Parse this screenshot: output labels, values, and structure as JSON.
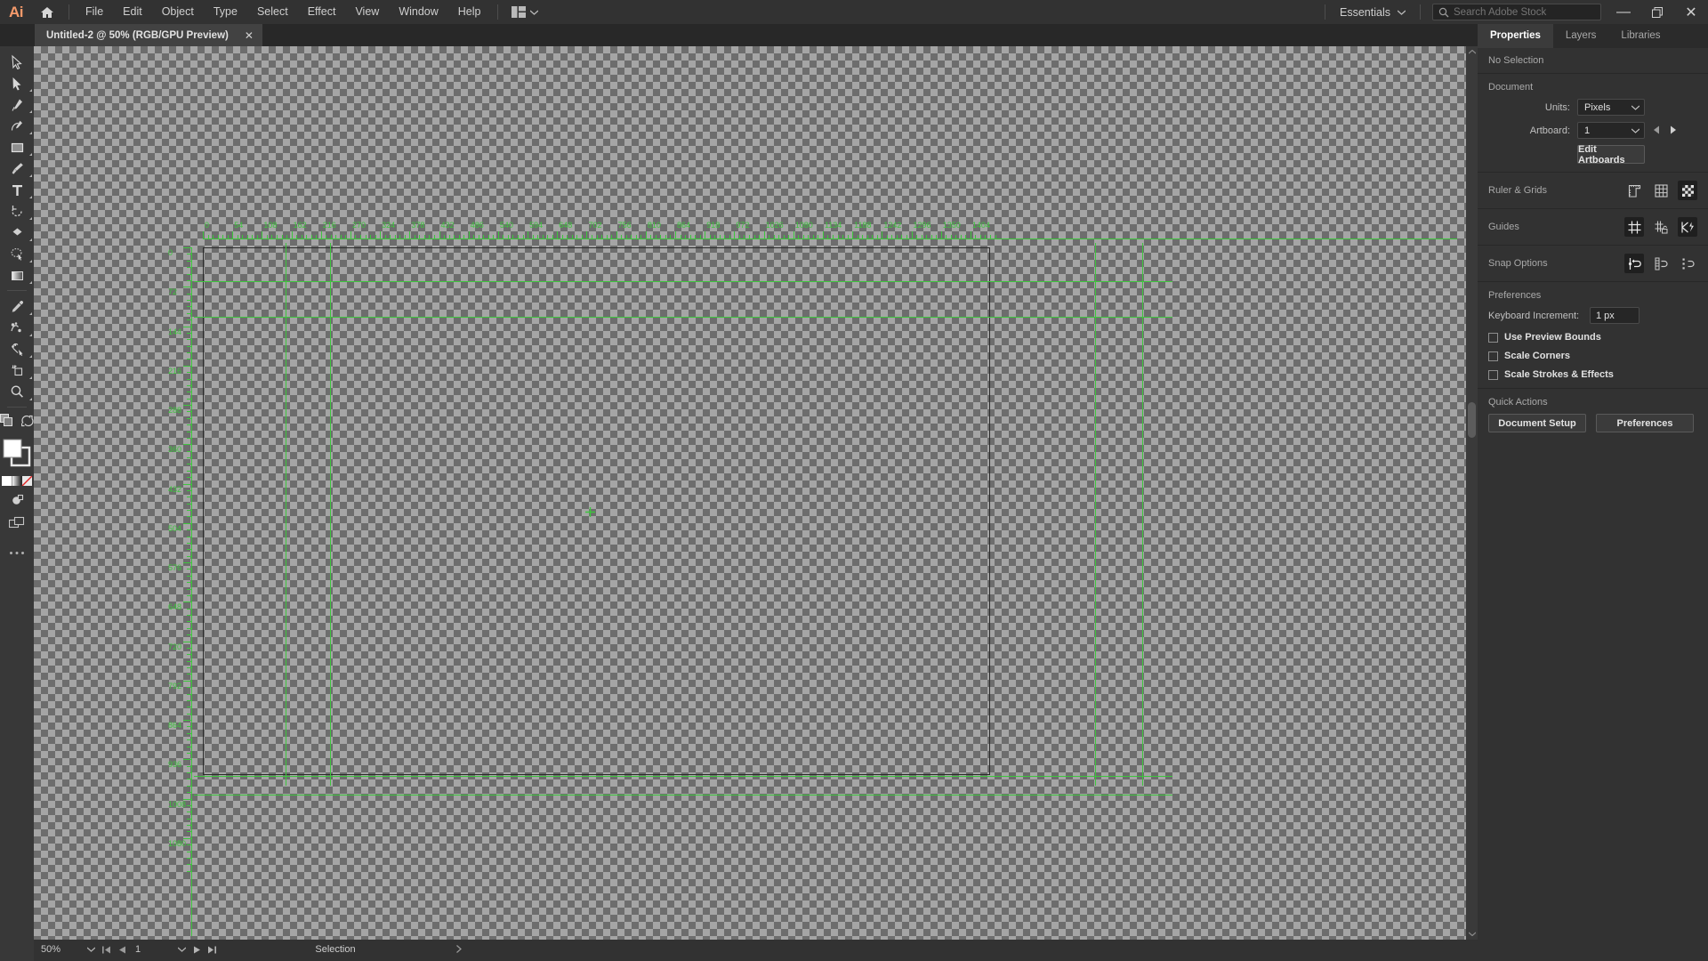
{
  "app": {
    "name": "Ai",
    "home_icon": "home-icon"
  },
  "menu": {
    "items": [
      "File",
      "Edit",
      "Object",
      "Type",
      "Select",
      "Effect",
      "View",
      "Window",
      "Help"
    ],
    "workspace_switcher_icon": "layout-switcher-icon"
  },
  "menubar_right": {
    "workspace": "Essentials",
    "search_placeholder": "Search Adobe Stock",
    "search_value": "",
    "search_icon": "search-icon",
    "minimize": "—",
    "restore": "❐",
    "close": "✕"
  },
  "document_tab": {
    "title": "Untitled-2 @ 50% (RGB/GPU Preview)",
    "close": "✕"
  },
  "panel_collapse_icon": "double-chevron-right-icon",
  "toolbar": {
    "tools": [
      {
        "name": "selection-tool",
        "icon": "arrow-outline-icon",
        "more": false
      },
      {
        "name": "direct-selection-tool",
        "icon": "arrow-solid-icon",
        "more": true
      },
      {
        "name": "pen-tool",
        "icon": "pen-icon",
        "more": true
      },
      {
        "name": "curvature-tool",
        "icon": "curvature-icon",
        "more": true
      },
      {
        "name": "rectangle-tool",
        "icon": "rectangle-icon",
        "more": true
      },
      {
        "name": "paintbrush-tool",
        "icon": "paintbrush-icon",
        "more": true
      },
      {
        "name": "type-tool",
        "icon": "type-icon",
        "more": true
      },
      {
        "name": "rotate-tool",
        "icon": "rotate-icon",
        "more": true
      },
      {
        "name": "shape-builder-tool",
        "icon": "shape-builder-icon",
        "more": true
      },
      {
        "name": "free-transform-tool",
        "icon": "free-transform-icon",
        "more": true
      },
      {
        "name": "gradient-tool",
        "icon": "gradient-icon",
        "more": true
      },
      {
        "name": "eyedropper-tool",
        "icon": "eyedropper-icon",
        "more": true
      },
      {
        "name": "blend-tool",
        "icon": "blend-icon",
        "more": true
      },
      {
        "name": "symbol-sprayer-tool",
        "icon": "symbol-sprayer-icon",
        "more": true
      },
      {
        "name": "artboard-tool",
        "icon": "artboard-icon",
        "more": true
      },
      {
        "name": "zoom-tool",
        "icon": "magnifier-icon",
        "more": true
      }
    ],
    "swap_fill_stroke_icon": "swap-arrows-icon",
    "default_fill_stroke_icon": "default-fill-stroke-icon",
    "fill_color": "#ffffff",
    "stroke_color": "#000000",
    "color_mode_icons": [
      "color-swatch-icon",
      "gradient-swatch-icon",
      "none-swatch-icon"
    ],
    "draw_mode_icon": "draw-normal-icon",
    "screen_mode_icon": "screen-mode-icon",
    "more_tools_icon": "ellipsis-icon"
  },
  "canvas": {
    "checker_light": "#a5a5a5",
    "checker_dark": "#6d6d6d",
    "guide_color": "#3ec53e",
    "artboard_border": "#2a2a2a",
    "center_marker_icon": "crosshair-icon",
    "ruler_h": {
      "step": 54,
      "labels": [
        0,
        54,
        108,
        162,
        216,
        270,
        324,
        378,
        432,
        486,
        540,
        594,
        648,
        702,
        756,
        810,
        864,
        918,
        972,
        1026,
        1080,
        1134,
        1188,
        1242,
        1296,
        1350,
        1404
      ]
    },
    "ruler_v": {
      "step": 72,
      "labels": [
        0,
        72,
        144,
        216,
        288,
        360,
        432,
        504,
        576,
        648,
        720,
        792,
        864,
        936,
        1008,
        1080
      ]
    },
    "guides_horizontal": [
      264,
      304,
      820,
      841
    ],
    "guides_vertical": [
      283,
      333,
      1193,
      1246
    ]
  },
  "scrollbars": {
    "v_up_icon": "chevron-up-icon",
    "v_down_icon": "chevron-down-icon",
    "h_right_icon": "chevron-right-icon"
  },
  "statusbar": {
    "zoom": "50%",
    "zoom_caret_icon": "chevron-down-icon",
    "first_icon": "first-artboard-icon",
    "prev_icon": "prev-artboard-icon",
    "page": "1",
    "page_caret_icon": "chevron-down-icon",
    "next_icon": "next-artboard-icon",
    "last_icon": "last-artboard-icon",
    "status": "Selection",
    "status_arrow_icon": "chevron-right-icon"
  },
  "properties_panel": {
    "tabs": [
      {
        "label": "Properties",
        "active": true
      },
      {
        "label": "Layers",
        "active": false
      },
      {
        "label": "Libraries",
        "active": false
      }
    ],
    "selection_state": "No Selection",
    "document": {
      "heading": "Document",
      "units_label": "Units:",
      "units_value": "Pixels",
      "artboard_label": "Artboard:",
      "artboard_value": "1",
      "prev_artboard_icon": "triangle-left-icon",
      "next_artboard_icon": "triangle-right-icon",
      "edit_artboards_label": "Edit Artboards"
    },
    "ruler_grids": {
      "label": "Ruler & Grids",
      "buttons": [
        {
          "name": "show-rulers-icon",
          "active": false
        },
        {
          "name": "show-grid-icon",
          "active": false
        },
        {
          "name": "show-transparency-grid-icon",
          "active": true
        }
      ]
    },
    "guides": {
      "label": "Guides",
      "buttons": [
        {
          "name": "show-guides-icon",
          "active": true
        },
        {
          "name": "lock-guides-icon",
          "active": false
        },
        {
          "name": "smart-guides-icon",
          "active": true
        }
      ]
    },
    "snap_options": {
      "label": "Snap Options",
      "buttons": [
        {
          "name": "snap-to-point-icon",
          "active": true
        },
        {
          "name": "snap-to-grid-icon",
          "active": false
        },
        {
          "name": "snap-to-pixel-icon",
          "active": false
        }
      ]
    },
    "preferences": {
      "heading": "Preferences",
      "keyboard_increment_label": "Keyboard Increment:",
      "keyboard_increment_value": "1 px",
      "checkboxes": [
        {
          "label": "Use Preview Bounds",
          "checked": false
        },
        {
          "label": "Scale Corners",
          "checked": false
        },
        {
          "label": "Scale Strokes & Effects",
          "checked": false
        }
      ]
    },
    "quick_actions": {
      "heading": "Quick Actions",
      "buttons": [
        "Document Setup",
        "Preferences"
      ]
    }
  }
}
